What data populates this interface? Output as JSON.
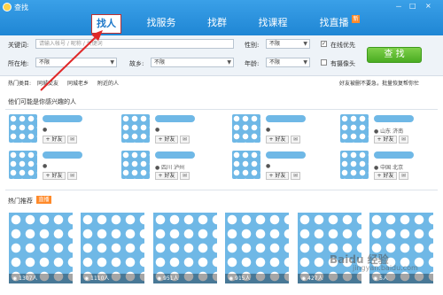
{
  "window": {
    "title": "查找",
    "controls": [
      "－",
      "□",
      "×"
    ]
  },
  "tabs": [
    {
      "label": "找人",
      "active": true
    },
    {
      "label": "找服务",
      "active": false
    },
    {
      "label": "找群",
      "active": false
    },
    {
      "label": "找课程",
      "active": false
    },
    {
      "label": "找直播",
      "active": false,
      "badge": "新"
    }
  ],
  "search": {
    "keyword_label": "关键词:",
    "keyword_placeholder": "请输入帐号 / 昵称 / 关键词",
    "gender_label": "性别:",
    "gender_value": "不限",
    "online_label": "在线优先",
    "location_label": "所在地:",
    "location_value": "不限",
    "hometown_label": "故乡:",
    "hometown_value": "不限",
    "age_label": "年龄:",
    "age_value": "不限",
    "camera_label": "有摄像头",
    "find_button": "查 找"
  },
  "hot": {
    "label": "热门类目:",
    "items": [
      "同城交友",
      "同城老乡",
      "附近的人"
    ],
    "right_text": "好友被删不要急，批量恢复帮你忙"
  },
  "people": {
    "title": "他们可能是你感兴趣的人",
    "add_label": "+ 好友",
    "cards": [
      {
        "location": ""
      },
      {
        "location": ""
      },
      {
        "location": ""
      },
      {
        "location": "山东 济南"
      },
      {
        "location": ""
      },
      {
        "location": "四川 泸州"
      },
      {
        "location": ""
      },
      {
        "location": "中国 北京"
      }
    ]
  },
  "live": {
    "title": "热门推荐",
    "badge": "直播",
    "items": [
      {
        "viewers": "1307人"
      },
      {
        "viewers": "1110人"
      },
      {
        "viewers": "951人"
      },
      {
        "viewers": "915人"
      },
      {
        "viewers": "427人"
      },
      {
        "viewers": "5人"
      }
    ]
  },
  "watermark": {
    "main": "Baidu 经验",
    "sub": "jingyan.baidu.com"
  },
  "colors": {
    "header": "#1f86d4",
    "accent": "#ff8a2a",
    "find_button": "#4aac22",
    "arrow": "#e02828"
  }
}
